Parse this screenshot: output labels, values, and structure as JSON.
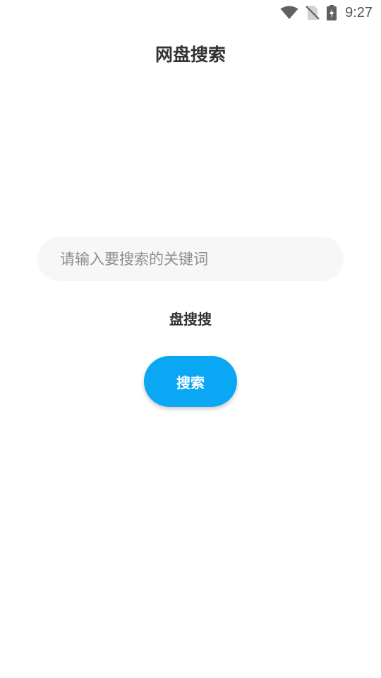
{
  "status_bar": {
    "time": "9:27",
    "icons": [
      "wifi-icon",
      "no-sim-icon",
      "battery-charging-icon"
    ]
  },
  "header": {
    "title": "网盘搜索"
  },
  "search": {
    "placeholder": "请输入要搜索的关键词",
    "value": ""
  },
  "engine": {
    "label": "盘搜搜"
  },
  "actions": {
    "search_label": "搜索"
  },
  "colors": {
    "accent": "#0aa7f5",
    "title_text": "#333333",
    "placeholder": "#8e8e93",
    "input_background": "#f7f7f8"
  }
}
